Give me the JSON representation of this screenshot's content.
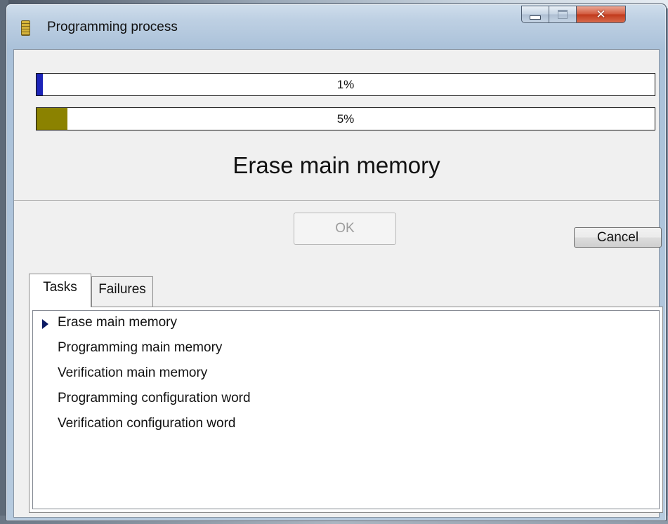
{
  "window": {
    "title": "Programming process",
    "icon": "chip-icon",
    "controls": {
      "minimize": "minimize-icon",
      "maximize": "maximize-icon",
      "close": "close-icon"
    }
  },
  "progress": [
    {
      "label": "1%",
      "value": 1,
      "color": "#1c24b8"
    },
    {
      "label": "5%",
      "value": 5,
      "color": "#8b8200"
    }
  ],
  "status_text": "Erase main memory",
  "buttons": {
    "ok_label": "OK",
    "ok_enabled": false,
    "cancel_label": "Cancel"
  },
  "tabs": [
    {
      "label": "Tasks",
      "selected": true
    },
    {
      "label": "Failures",
      "selected": false
    }
  ],
  "tasks": [
    {
      "label": "Erase main memory",
      "current": true
    },
    {
      "label": "Programming main memory",
      "current": false
    },
    {
      "label": "Verification main memory",
      "current": false
    },
    {
      "label": "Programming configuration word",
      "current": false
    },
    {
      "label": "Verification configuration word",
      "current": false
    }
  ]
}
